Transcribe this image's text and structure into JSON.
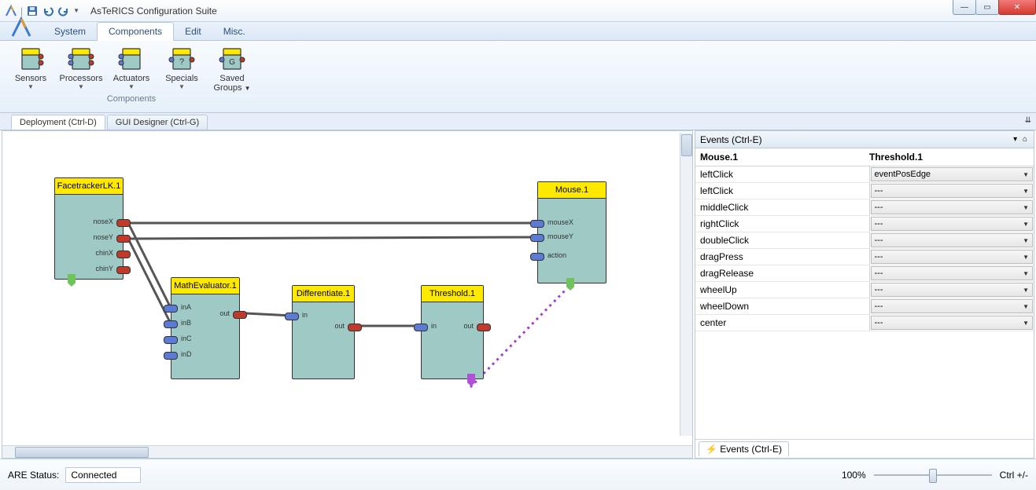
{
  "window": {
    "title": "AsTeRICS Configuration Suite"
  },
  "qat": {
    "save": "save-icon",
    "undo": "undo-icon",
    "redo": "redo-icon"
  },
  "ribbon": {
    "tabs": [
      "System",
      "Components",
      "Edit",
      "Misc."
    ],
    "active": "Components",
    "group_label": "Components",
    "buttons": [
      "Sensors",
      "Processors",
      "Actuators",
      "Specials",
      "Saved Groups"
    ]
  },
  "workspace_tabs": {
    "items": [
      "Deployment (Ctrl-D)",
      "GUI Designer (Ctrl-G)"
    ],
    "active": 0
  },
  "events_panel": {
    "title": "Events (Ctrl-E)",
    "col_left": "Mouse.1",
    "col_right": "Threshold.1",
    "rows": [
      {
        "label": "leftClick",
        "value": "eventPosEdge"
      },
      {
        "label": "leftClick",
        "value": "---"
      },
      {
        "label": "middleClick",
        "value": "---"
      },
      {
        "label": "rightClick",
        "value": "---"
      },
      {
        "label": "doubleClick",
        "value": "---"
      },
      {
        "label": "dragPress",
        "value": "---"
      },
      {
        "label": "dragRelease",
        "value": "---"
      },
      {
        "label": "wheelUp",
        "value": "---"
      },
      {
        "label": "wheelDown",
        "value": "---"
      },
      {
        "label": "center",
        "value": "---"
      }
    ],
    "bottom_tab": "Events (Ctrl-E)"
  },
  "status": {
    "label": "ARE Status:",
    "value": "Connected",
    "zoom": "100%",
    "zoom_hint": "Ctrl +/-"
  },
  "canvas": {
    "components": {
      "facetracker": {
        "title": "FacetrackerLK.1",
        "outputs": [
          "noseX",
          "noseY",
          "chinX",
          "chinY"
        ]
      },
      "math": {
        "title": "MathEvaluator.1",
        "inputs": [
          "inA",
          "inB",
          "inC",
          "inD"
        ],
        "outputs": [
          "out"
        ]
      },
      "diff": {
        "title": "Differentiate.1",
        "inputs": [
          "in"
        ],
        "outputs": [
          "out"
        ]
      },
      "thresh": {
        "title": "Threshold.1",
        "inputs": [
          "in"
        ],
        "outputs": [
          "out"
        ]
      },
      "mouse": {
        "title": "Mouse.1",
        "inputs": [
          "mouseX",
          "mouseY",
          "action"
        ]
      }
    }
  }
}
